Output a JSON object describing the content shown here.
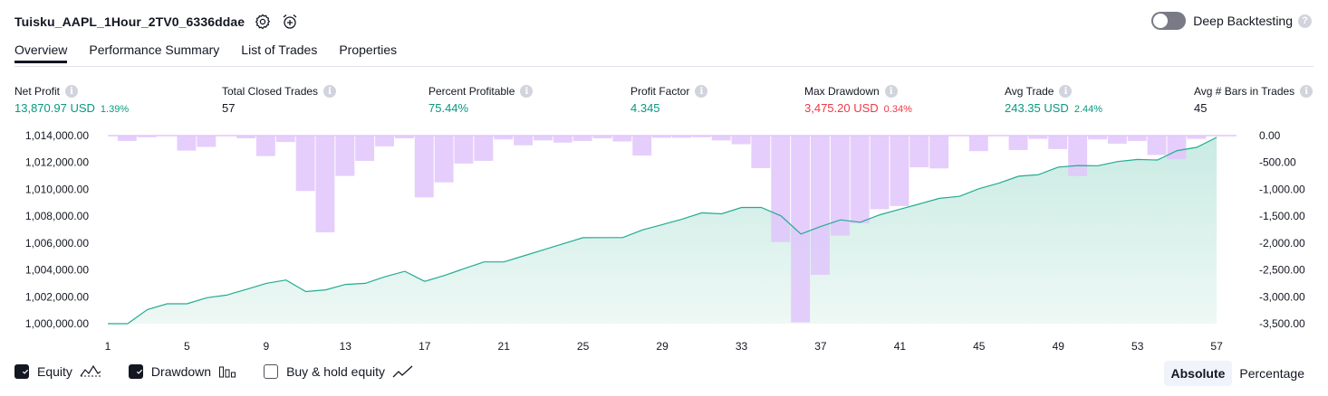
{
  "header": {
    "title": "Tuisku_AAPL_1Hour_2TV0_6336ddae",
    "settings_icon": "gear-icon",
    "alert_icon": "alarm-add-icon"
  },
  "deep_backtesting": {
    "label": "Deep Backtesting",
    "enabled": false,
    "help": "?"
  },
  "tabs": [
    {
      "label": "Overview",
      "active": true
    },
    {
      "label": "Performance Summary",
      "active": false
    },
    {
      "label": "List of Trades",
      "active": false
    },
    {
      "label": "Properties",
      "active": false
    }
  ],
  "metrics": [
    {
      "label": "Net Profit",
      "value": "13,870.97 USD",
      "pct": "1.39%",
      "tone": "green"
    },
    {
      "label": "Total Closed Trades",
      "value": "57",
      "pct": "",
      "tone": "dark"
    },
    {
      "label": "Percent Profitable",
      "value": "75.44%",
      "pct": "",
      "tone": "green"
    },
    {
      "label": "Profit Factor",
      "value": "4.345",
      "pct": "",
      "tone": "green"
    },
    {
      "label": "Max Drawdown",
      "value": "3,475.20 USD",
      "pct": "0.34%",
      "tone": "red"
    },
    {
      "label": "Avg Trade",
      "value": "243.35 USD",
      "pct": "2.44%",
      "tone": "green"
    },
    {
      "label": "Avg # Bars in Trades",
      "value": "45",
      "pct": "",
      "tone": "dark"
    }
  ],
  "info_glyph": "i",
  "legend": {
    "equity": {
      "label": "Equity",
      "checked": true
    },
    "drawdown": {
      "label": "Drawdown",
      "checked": true
    },
    "buy_hold": {
      "label": "Buy & hold equity",
      "checked": false
    }
  },
  "view_mode": {
    "options": [
      "Absolute",
      "Percentage"
    ],
    "selected": "Absolute"
  },
  "colors": {
    "equity_line": "#22ab94",
    "equity_fill": "#c9ebe3",
    "drawdown_bar": "#e1c5fb",
    "drawdown_line": "#d9a6f7",
    "equity_overlap": "#5b8fd9",
    "axis_text": "#131722"
  },
  "chart_data": {
    "type": "area",
    "x_ticks": [
      "1",
      "5",
      "9",
      "13",
      "17",
      "21",
      "25",
      "29",
      "33",
      "37",
      "41",
      "45",
      "49",
      "53",
      "57"
    ],
    "y_left": {
      "ticks": [
        "1,014,000.00",
        "1,012,000.00",
        "1,010,000.00",
        "1,008,000.00",
        "1,006,000.00",
        "1,004,000.00",
        "1,002,000.00",
        "1,000,000.00"
      ],
      "min": 1000000,
      "max": 1014000
    },
    "y_right": {
      "ticks": [
        "0.00",
        "-500.00",
        "-1,000.00",
        "-1,500.00",
        "-2,000.00",
        "-2,500.00",
        "-3,000.00",
        "-3,500.00"
      ],
      "min": -3500,
      "max": 0
    },
    "x_range": [
      1,
      58
    ],
    "series": [
      {
        "name": "Equity",
        "type": "area",
        "values": [
          1000000,
          1000000,
          1001050,
          1001480,
          1001480,
          1001930,
          1002130,
          1002550,
          1003000,
          1003250,
          1002390,
          1002520,
          1002920,
          1003000,
          1003490,
          1003900,
          1003150,
          1003590,
          1004100,
          1004600,
          1004600,
          1005050,
          1005500,
          1005950,
          1006400,
          1006410,
          1006410,
          1006980,
          1007380,
          1007780,
          1008250,
          1008180,
          1008650,
          1008650,
          1008020,
          1006680,
          1007230,
          1007730,
          1007550,
          1008110,
          1008520,
          1008920,
          1009330,
          1009480,
          1010050,
          1010460,
          1010980,
          1011090,
          1011660,
          1011770,
          1011760,
          1012070,
          1012220,
          1012180,
          1012880,
          1013130,
          1013870
        ]
      },
      {
        "name": "Drawdown",
        "type": "bar",
        "values": [
          0,
          -100,
          -30,
          0,
          -280,
          -210,
          0,
          -50,
          -380,
          -120,
          -1030,
          -1800,
          -750,
          -470,
          -200,
          -50,
          -1150,
          -870,
          -520,
          -470,
          -70,
          -180,
          -90,
          -130,
          -100,
          -50,
          -110,
          -370,
          -40,
          -40,
          -30,
          -90,
          -160,
          -605,
          -1980,
          -3475,
          -2590,
          -1860,
          -1630,
          -1370,
          -1310,
          -590,
          -610,
          0,
          -290,
          0,
          -270,
          -60,
          -250,
          -750,
          -70,
          -150,
          -100,
          -360,
          -440,
          -60,
          0
        ]
      }
    ]
  }
}
